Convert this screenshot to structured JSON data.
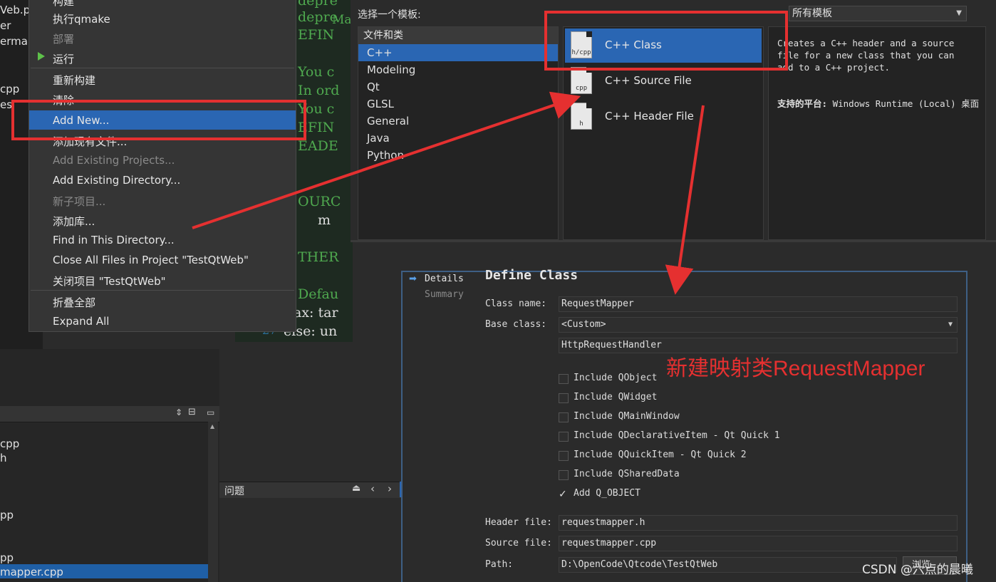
{
  "left_panel": {
    "top_fragments": [
      "Veb.pr",
      "er",
      "ermar",
      "cpp",
      "es"
    ],
    "bottom_fragments": [
      "cpp",
      "h",
      "pp",
      "pp",
      "mapper.cpp"
    ]
  },
  "code_editor": {
    "lines": [
      {
        "text": "depre",
        "color": "green"
      },
      {
        "text": "depre",
        "color": "green"
      },
      {
        "text": "EFIN",
        "color": "green"
      },
      {
        "text": "You c",
        "color": "green"
      },
      {
        "text": "In ord",
        "color": "green"
      },
      {
        "text": "You c",
        "color": "green"
      },
      {
        "text": "EFIN",
        "color": "green"
      },
      {
        "text": "EADE",
        "color": "green"
      },
      {
        "text": "OURC",
        "color": "green"
      },
      {
        "text": "m",
        "color": "white"
      },
      {
        "text": "THER",
        "color": "green"
      },
      {
        "text": "Defau",
        "color": "green"
      },
      {
        "text": "ax: tar",
        "color": "white"
      },
      {
        "text": "else: un",
        "color": "white"
      }
    ],
    "line_number": "27",
    "edge_text": "Ma"
  },
  "context_menu": {
    "items": [
      {
        "label": "构建",
        "enabled": true
      },
      {
        "label": "执行qmake",
        "enabled": true
      },
      {
        "label": "部署",
        "enabled": false
      },
      {
        "label": "运行",
        "enabled": true
      },
      {
        "label": "重新构建",
        "enabled": true
      },
      {
        "label": "清除",
        "enabled": true
      },
      {
        "label": "Add New...",
        "enabled": true
      },
      {
        "label": "添加现有文件...",
        "enabled": true
      },
      {
        "label": "Add Existing Projects...",
        "enabled": false
      },
      {
        "label": "Add Existing Directory...",
        "enabled": true
      },
      {
        "label": "新子项目...",
        "enabled": false
      },
      {
        "label": "添加库...",
        "enabled": true
      },
      {
        "label": "Find in This Directory...",
        "enabled": true
      },
      {
        "label": "Close All Files in Project \"TestQtWeb\"",
        "enabled": true
      },
      {
        "label": "关闭项目 \"TestQtWeb\"",
        "enabled": true
      },
      {
        "label": "折叠全部",
        "enabled": true
      },
      {
        "label": "Expand All",
        "enabled": true
      }
    ]
  },
  "template_dialog": {
    "label": "选择一个模板:",
    "filter_value": "所有模板",
    "category_header": "文件和类",
    "categories": [
      "C++",
      "Modeling",
      "Qt",
      "GLSL",
      "General",
      "Java",
      "Python"
    ],
    "files": [
      {
        "label": "C++ Class",
        "icon_text": "h/cpp"
      },
      {
        "label": "C++ Source File",
        "icon_text": "cpp"
      },
      {
        "label": "C++ Header File",
        "icon_text": "h"
      }
    ],
    "description": "Creates a C++ header and a source file for a new class that you can add to a C++ project.",
    "platform_label": "支持的平台:",
    "platform_value": "Windows Runtime (Local) 桌面"
  },
  "class_dialog": {
    "steps": [
      "Details",
      "Summary"
    ],
    "title": "Define Class",
    "class_name_label": "Class name:",
    "class_name": "RequestMapper",
    "base_class_label": "Base class:",
    "base_class": "<Custom>",
    "custom_base": "HttpRequestHandler",
    "options": [
      {
        "label": "Include QObject",
        "checked": false
      },
      {
        "label": "Include QWidget",
        "checked": false
      },
      {
        "label": "Include QMainWindow",
        "checked": false
      },
      {
        "label": "Include QDeclarativeItem - Qt Quick 1",
        "checked": false
      },
      {
        "label": "Include QQuickItem - Qt Quick 2",
        "checked": false
      },
      {
        "label": "Include QSharedData",
        "checked": false
      },
      {
        "label": "Add Q_OBJECT",
        "checked": true
      }
    ],
    "header_file_label": "Header file:",
    "header_file": "requestmapper.h",
    "source_file_label": "Source file:",
    "source_file": "requestmapper.cpp",
    "path_label": "Path:",
    "path": "D:\\OpenCode\\Qtcode\\TestQtWeb",
    "browse_label": "浏览..."
  },
  "issues_panel": {
    "title": "问题"
  },
  "annotation": "新建映射类RequestMapper",
  "watermark": "CSDN @六点的晨曦",
  "colors": {
    "highlight": "#2a66b3",
    "annotation_red": "#e53030",
    "code_green": "#4fa94f"
  }
}
